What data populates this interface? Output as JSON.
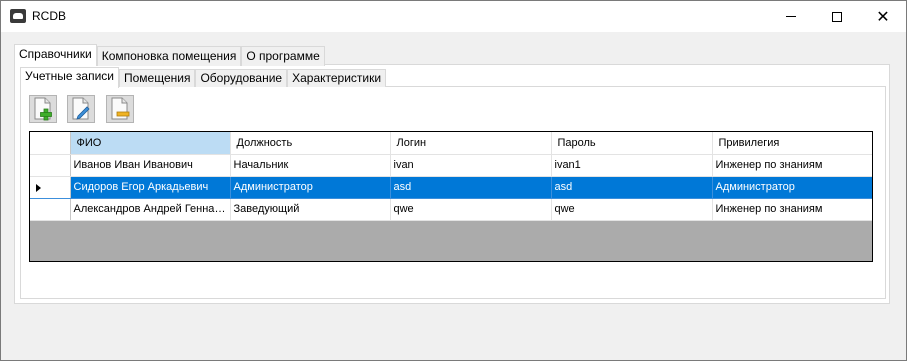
{
  "window": {
    "title": "RCDB"
  },
  "outer_tabs": [
    "Справочники",
    "Компоновка помещения",
    "О программе"
  ],
  "inner_tabs": [
    "Учетные записи",
    "Помещения",
    "Оборудование",
    "Характеристики"
  ],
  "toolbar": {
    "add_icon": "add-document-icon",
    "edit_icon": "edit-document-icon",
    "delete_icon": "remove-document-icon"
  },
  "grid": {
    "columns": [
      "ФИО",
      "Должность",
      "Логин",
      "Пароль",
      "Привилегия"
    ],
    "rows": [
      [
        "Иванов Иван Иванович",
        "Начальник",
        "ivan",
        "ivan1",
        "Инженер по знаниям"
      ],
      [
        "Сидоров Егор Аркадьевич",
        "Администратор",
        "asd",
        "asd",
        "Администратор"
      ],
      [
        "Александров Андрей Геннадьевич",
        "Заведующий",
        "qwe",
        "qwe",
        "Инженер по знаниям"
      ]
    ],
    "selected_row": 1
  },
  "colors": {
    "selection": "#0078d7",
    "header_selected": "#bcdcf4",
    "grid_background": "#ababab"
  }
}
